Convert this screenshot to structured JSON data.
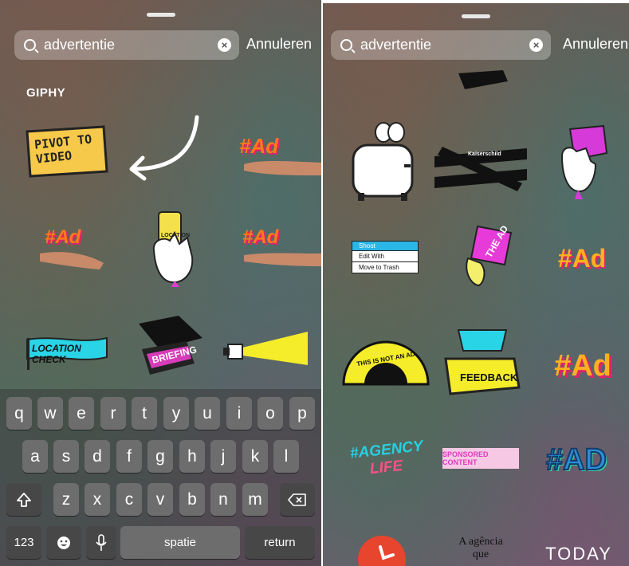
{
  "left": {
    "search": {
      "query": "advertentie",
      "cancel_label": "Annuleren"
    },
    "section_label": "GIPHY",
    "stickers": {
      "pivot_line1": "PIVOT TO",
      "pivot_line2": "VIDEO",
      "ad": "#Ad",
      "location": "LOCATION",
      "location_check": "LOCATION CHECK",
      "briefing": "BRIEFING"
    }
  },
  "keyboard": {
    "row1": [
      "q",
      "w",
      "e",
      "r",
      "t",
      "y",
      "u",
      "i",
      "o",
      "p"
    ],
    "row2": [
      "a",
      "s",
      "d",
      "f",
      "g",
      "h",
      "j",
      "k",
      "l"
    ],
    "row3": [
      "z",
      "x",
      "c",
      "v",
      "b",
      "n",
      "m"
    ],
    "numbers_label": "123",
    "space_label": "spatie",
    "return_label": "return"
  },
  "right": {
    "search": {
      "query": "advertentie",
      "cancel_label": "Annuleren"
    },
    "stickers": {
      "kaiserschild": "Kaiserschild",
      "menu_shoot": "Shoot",
      "menu_edit": "Edit With",
      "menu_trash": "Move to Trash",
      "the_ad": "THE AD",
      "fan_text": "THIS IS NOT AN AD",
      "feedback": "FEEDBACK",
      "ad": "#Ad",
      "agency_line1": "#AGENCY",
      "agency_line2": "LIFE",
      "sponsored": "SPONSORED CONTENT",
      "ad_caps": "#AD",
      "agencia_line1": "A agência",
      "agencia_line2": "que",
      "today": "TODAY"
    }
  }
}
